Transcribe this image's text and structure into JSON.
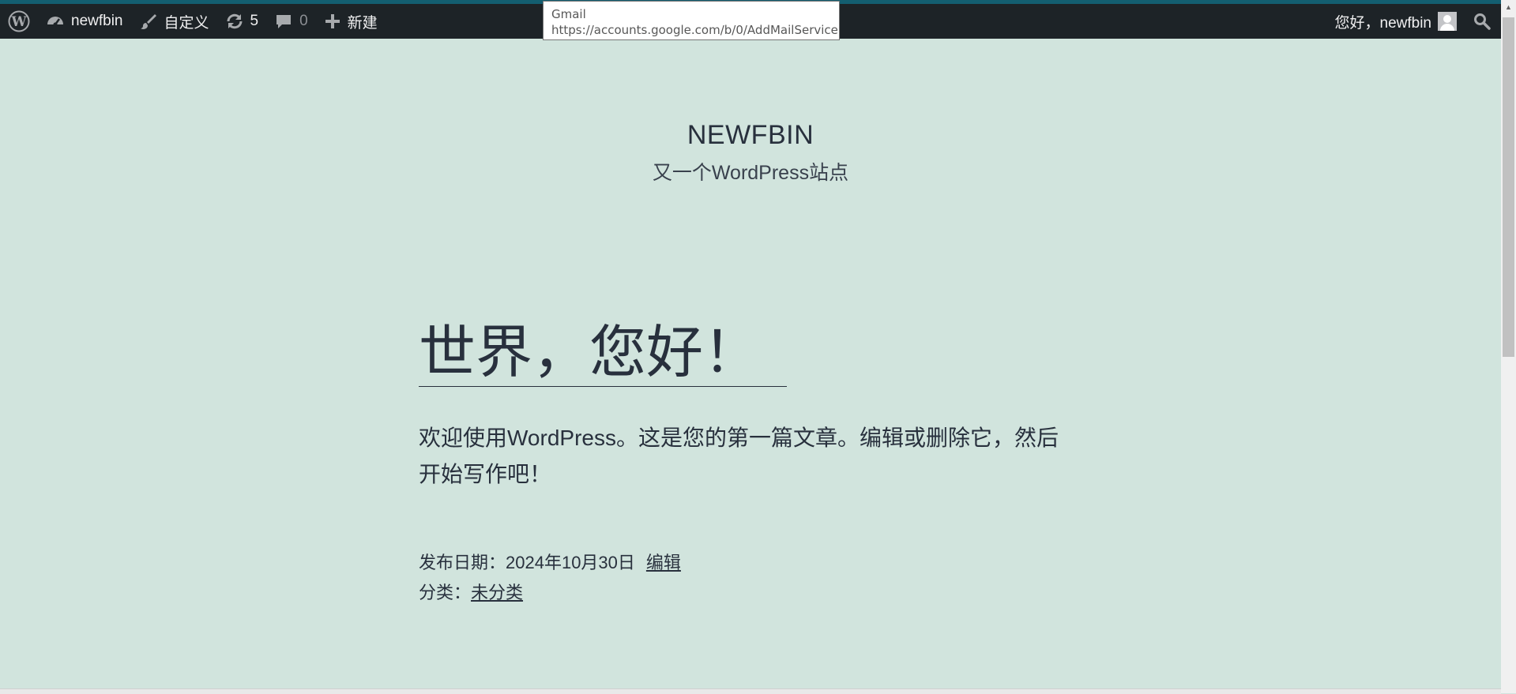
{
  "admin_bar": {
    "site_name": "newfbin",
    "customize_label": "自定义",
    "updates_count": "5",
    "comments_count": "0",
    "new_label": "新建",
    "greeting": "您好，newfbin"
  },
  "tooltip": {
    "title": "Gmail",
    "url": "https://accounts.google.com/b/0/AddMailService"
  },
  "site": {
    "title": "NEWFBIN",
    "description": "又一个WordPress站点"
  },
  "post": {
    "title": "世界，您好！",
    "content": "欢迎使用WordPress。这是您的第一篇文章。编辑或删除它，然后开始写作吧！",
    "published_label": "发布日期：",
    "published_date": "2024年10月30日",
    "edit_label": "编辑",
    "category_label": "分类：",
    "category_value": "未分类"
  },
  "colors": {
    "background": "#d1e4dd",
    "admin_bar": "#1d2327",
    "text": "#28303d"
  }
}
